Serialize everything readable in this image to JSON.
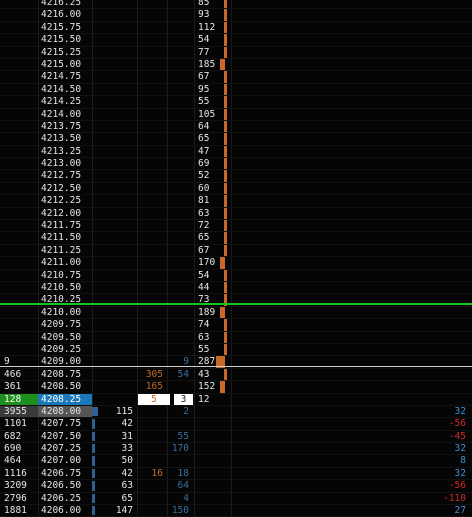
{
  "ladder": {
    "rows": [
      {
        "price": "4216.25",
        "ask": "85",
        "ask_bar": 0.15
      },
      {
        "price": "4216.00",
        "ask": "93",
        "ask_bar": 0.15
      },
      {
        "price": "4215.75",
        "ask": "112",
        "ask_bar": 0.15
      },
      {
        "price": "4215.50",
        "ask": "54",
        "ask_bar": 0.15
      },
      {
        "price": "4215.25",
        "ask": "77",
        "ask_bar": 0.15
      },
      {
        "price": "4215.00",
        "ask": "185",
        "ask_bar": 0.55
      },
      {
        "price": "4214.75",
        "ask": "67",
        "ask_bar": 0.15
      },
      {
        "price": "4214.50",
        "ask": "95",
        "ask_bar": 0.15
      },
      {
        "price": "4214.25",
        "ask": "55",
        "ask_bar": 0.15
      },
      {
        "price": "4214.00",
        "ask": "105",
        "ask_bar": 0.15
      },
      {
        "price": "4213.75",
        "ask": "64",
        "ask_bar": 0.15
      },
      {
        "price": "4213.50",
        "ask": "65",
        "ask_bar": 0.15
      },
      {
        "price": "4213.25",
        "ask": "47",
        "ask_bar": 0.15
      },
      {
        "price": "4213.00",
        "ask": "69",
        "ask_bar": 0.15
      },
      {
        "price": "4212.75",
        "ask": "52",
        "ask_bar": 0.15
      },
      {
        "price": "4212.50",
        "ask": "60",
        "ask_bar": 0.15
      },
      {
        "price": "4212.25",
        "ask": "81",
        "ask_bar": 0.15
      },
      {
        "price": "4212.00",
        "ask": "63",
        "ask_bar": 0.15
      },
      {
        "price": "4211.75",
        "ask": "72",
        "ask_bar": 0.15
      },
      {
        "price": "4211.50",
        "ask": "65",
        "ask_bar": 0.15
      },
      {
        "price": "4211.25",
        "ask": "67",
        "ask_bar": 0.15
      },
      {
        "price": "4211.00",
        "ask": "170",
        "ask_bar": 0.55
      },
      {
        "price": "4210.75",
        "ask": "54",
        "ask_bar": 0.15
      },
      {
        "price": "4210.50",
        "ask": "44",
        "ask_bar": 0.15
      },
      {
        "price": "4210.25",
        "ask": "73",
        "ask_bar": 0.15
      },
      {
        "price": "4210.00",
        "ask": "189",
        "ask_bar": 0.55
      },
      {
        "price": "4209.75",
        "ask": "74",
        "ask_bar": 0.15
      },
      {
        "price": "4209.50",
        "ask": "63",
        "ask_bar": 0.15
      },
      {
        "price": "4209.25",
        "ask": "55",
        "ask_bar": 0.15
      },
      {
        "vol": "9",
        "price": "4209.00",
        "bidvol": "9",
        "ask": "287",
        "ask_bar": 0.95
      },
      {
        "vol": "466",
        "price": "4208.75",
        "bid": "305",
        "bidvol": "54",
        "ask": "43",
        "ask_bar": 0.15
      },
      {
        "vol": "361",
        "price": "4208.50",
        "bid": "165",
        "ask": "152",
        "ask_bar": 0.55
      },
      {
        "vol": "128",
        "price": "4208.25",
        "bid": "5",
        "ask": "3",
        "ask_plain": "12",
        "hl": "current"
      },
      {
        "vol": "3955",
        "price": "4208.00",
        "hist": "115",
        "hist_bar": 0.14,
        "bidvol": "2",
        "right": "32",
        "right_sign": "pos",
        "hl": "selected"
      },
      {
        "vol": "1101",
        "price": "4207.75",
        "hist": "42",
        "hist_bar": 0.05,
        "right": "-56",
        "right_sign": "neg"
      },
      {
        "vol": "682",
        "price": "4207.50",
        "hist": "31",
        "hist_bar": 0.05,
        "bidvol": "55",
        "right": "-45",
        "right_sign": "neg"
      },
      {
        "vol": "690",
        "price": "4207.25",
        "hist": "33",
        "hist_bar": 0.05,
        "bidvol": "170",
        "right": "32",
        "right_sign": "pos"
      },
      {
        "vol": "464",
        "price": "4207.00",
        "hist": "50",
        "hist_bar": 0.05,
        "right": "8",
        "right_sign": "pos"
      },
      {
        "vol": "1116",
        "price": "4206.75",
        "hist": "42",
        "hist_bar": 0.05,
        "bid": "16",
        "bidvol": "18",
        "right": "32",
        "right_sign": "pos"
      },
      {
        "vol": "3209",
        "price": "4206.50",
        "hist": "63",
        "hist_bar": 0.05,
        "bidvol": "64",
        "right": "-56",
        "right_sign": "neg"
      },
      {
        "vol": "2796",
        "price": "4206.25",
        "hist": "65",
        "hist_bar": 0.05,
        "bidvol": "4",
        "right": "-110",
        "right_sign": "neg"
      },
      {
        "vol": "1881",
        "price": "4206.00",
        "hist": "147",
        "hist_bar": 0.05,
        "bidvol": "150",
        "right": "27",
        "right_sign": "pos"
      }
    ]
  },
  "colors": {
    "ask_bar": "#c8682a",
    "hist_bar": "#2f5f93",
    "green_line": "#19c419",
    "current_vol": "#1e8f1e",
    "current_price": "#1b78b8"
  }
}
